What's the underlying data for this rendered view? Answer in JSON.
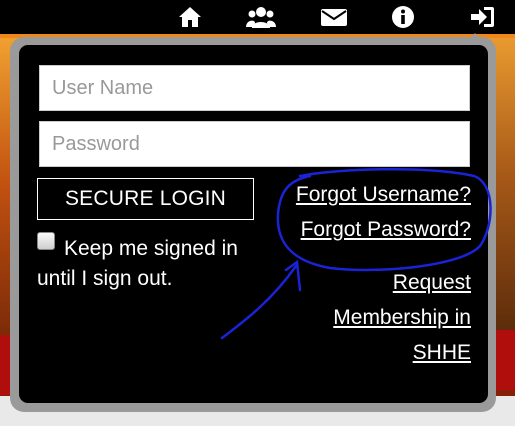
{
  "nav": {
    "icons": [
      "home-icon",
      "members-icon",
      "mail-icon",
      "info-icon",
      "sign-in-icon"
    ]
  },
  "login": {
    "username_placeholder": "User Name",
    "password_placeholder": "Password",
    "login_button": "SECURE LOGIN",
    "keep_signed_in": "Keep me signed in until I sign out.",
    "forgot_username": "Forgot Username?",
    "forgot_password": "Forgot Password?",
    "request_line1": "Request",
    "request_line2": "Membership in",
    "request_line3": "SHHE"
  },
  "colors": {
    "accent_annotation": "#1a23d6",
    "button_border": "#ffffff",
    "popup_border": "#9a9a9a"
  }
}
